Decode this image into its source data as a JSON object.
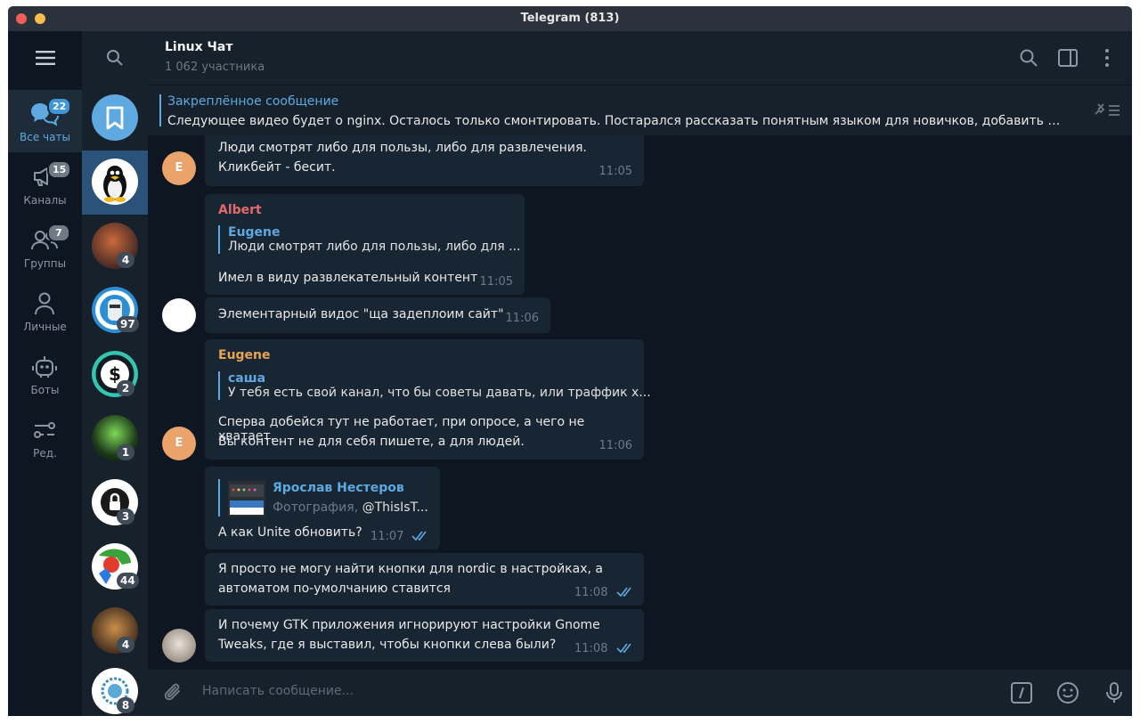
{
  "window": {
    "title": "Telegram (813)"
  },
  "folders": [
    {
      "label": "Все чаты",
      "badge": "22",
      "icon": "chats-icon"
    },
    {
      "label": "Каналы",
      "badge": "15",
      "icon": "channel-icon"
    },
    {
      "label": "Группы",
      "badge": "7",
      "icon": "group-icon"
    },
    {
      "label": "Личные",
      "badge": "",
      "icon": "person-icon"
    },
    {
      "label": "Боты",
      "badge": "",
      "icon": "bot-icon"
    },
    {
      "label": "Ред.",
      "badge": "",
      "icon": "edit-folders-icon"
    }
  ],
  "chats": [
    {
      "name": "saved-messages",
      "badge": ""
    },
    {
      "name": "linux-chat",
      "badge": ""
    },
    {
      "name": "chat-3",
      "badge": "4"
    },
    {
      "name": "chat-4",
      "badge": "97"
    },
    {
      "name": "chat-5",
      "badge": "2"
    },
    {
      "name": "chat-6",
      "badge": "1"
    },
    {
      "name": "chat-7",
      "badge": "3"
    },
    {
      "name": "chat-8",
      "badge": "44"
    },
    {
      "name": "chat-9",
      "badge": "4"
    },
    {
      "name": "chat-10",
      "badge": "8"
    }
  ],
  "header": {
    "title": "Linux Чат",
    "subtitle": "1 062 участника"
  },
  "pinned": {
    "title": "Закреплённое сообщение",
    "text": "Следующее видео будет о nginx. Осталось только смонтировать. Постарался рассказать понятным языком для новичков, добавить приме..."
  },
  "messages": [
    {
      "avatar_letter": "E",
      "lines": [
        "Люди смотрят либо для пользы, либо для развлечения.",
        "Кликбейт - бесит."
      ],
      "time": "11:05"
    },
    {
      "sender": "Albert",
      "sender_color": "#e5696b",
      "quote_name": "Eugene",
      "quote_text": "Люди смотрят либо для пользы, либо для ...",
      "lines": [
        "Имел в виду развлекательный контент"
      ],
      "time": "11:05"
    },
    {
      "lines": [
        "Элементарный видос \"ща задеплоим сайт\""
      ],
      "time": "11:06"
    },
    {
      "avatar_letter": "E",
      "sender": "Eugene",
      "sender_color": "#e8a54d",
      "quote_name": "саша",
      "quote_text": "У тебя есть свой канал, что бы советы давать, или траффик х...",
      "lines": [
        "Сперва добейся тут не работает, при опросе, а чего не хватает.",
        "Вы контент не для себя пишете, а для людей."
      ],
      "time": "11:06"
    },
    {
      "quote_name": "Ярослав Нестеров",
      "quote_type": "Фотография,",
      "quote_text": "@ThisIsT...",
      "lines": [
        "А как Unite обновить?"
      ],
      "time": "11:07"
    },
    {
      "lines": [
        "Я просто не могу найти кнопки для nordic в настройках, а",
        "автоматом по-умолчанию ставится"
      ],
      "time": "11:08"
    },
    {
      "lines": [
        "И почему GTK приложения игнорируют настройки Gnome",
        "Tweaks, где я выставил, чтобы кнопки слева были?"
      ],
      "time": "11:08"
    }
  ],
  "composer": {
    "placeholder": "Написать сообщение..."
  },
  "colors": {
    "accent": "#5ea9e0",
    "bg": "#0e1621",
    "panel": "#17212b",
    "bubble": "#182533"
  }
}
